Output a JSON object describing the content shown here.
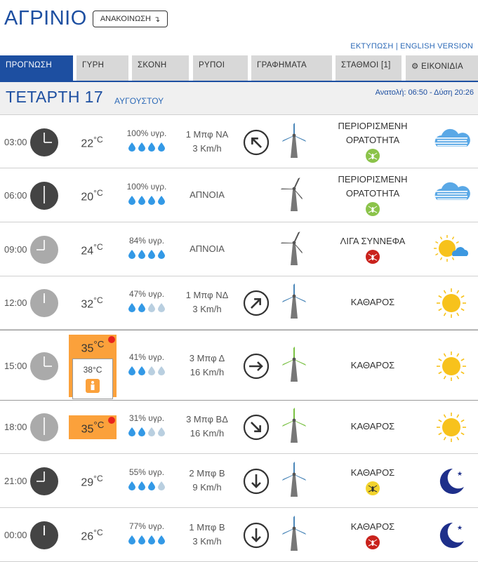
{
  "header": {
    "city": "ΑΓΡΙΝΙΟ",
    "announce_label": "ΑΝΑΚΟΙΝΩΣΗ",
    "print_link": "ΕΚΤΥΠΩΣΗ",
    "separator": "|",
    "english_link": "ENGLISH VERSION"
  },
  "tabs": [
    {
      "label": "ΠΡΟΓΝΩΣΗ",
      "active": true
    },
    {
      "label": "ΓΥΡΗ"
    },
    {
      "label": "ΣΚΟΝΗ"
    },
    {
      "label": "ΡΥΠΟΙ"
    },
    {
      "label": "ΓΡΑΦΗΜΑΤΑ"
    },
    {
      "label": "ΣΤΑΘΜΟΙ [1]"
    },
    {
      "label": "ΕΙΚΟΝΙΔΙΑ",
      "icon": "gear-icon"
    }
  ],
  "day": {
    "name": "ΤΕΤΑΡΤΗ 17",
    "month": "ΑΥΓΟΥΣΤΟΥ",
    "sun": "Ανατολή: 06:50  - Δύση 20:26"
  },
  "colors": {
    "brand": "#1d4fa1",
    "heat": "#fba13b",
    "drop_full": "#3399e6",
    "drop_empty": "#b9cfe0",
    "mosquito_green": "#8bc34a",
    "mosquito_red": "#c9221c",
    "mosquito_yellow": "#f2d32c"
  },
  "rows": [
    {
      "time": "03:00",
      "hour": 3,
      "clock": "dark",
      "temp": "22",
      "unit": "°C",
      "humidity": "100% υγρ.",
      "drops_full": 4,
      "wind1": "1 Μπφ ΝΑ",
      "wind2": "3 Km/h",
      "wind_dir": "NA",
      "turbine": "grey",
      "sky1": "ΠΕΡΙΟΡΙΣΜΕΝΗ",
      "sky2": "ΟΡΑΤΟΤΗΤΑ",
      "mosquito": "green",
      "weather": "fog-icon"
    },
    {
      "time": "06:00",
      "hour": 6,
      "clock": "dark",
      "temp": "20",
      "unit": "°C",
      "humidity": "100% υγρ.",
      "drops_full": 4,
      "wind1": "ΑΠΝΟΙΑ",
      "wind2": "",
      "wind_dir": "",
      "turbine": "calm",
      "sky1": "ΠΕΡΙΟΡΙΣΜΕΝΗ",
      "sky2": "ΟΡΑΤΟΤΗΤΑ",
      "mosquito": "green",
      "weather": "fog-icon"
    },
    {
      "time": "09:00",
      "hour": 9,
      "clock": "light",
      "temp": "24",
      "unit": "°C",
      "humidity": "84% υγρ.",
      "drops_full": 4,
      "wind1": "ΑΠΝΟΙΑ",
      "wind2": "",
      "wind_dir": "",
      "turbine": "calm",
      "sky1": "ΛΙΓΑ ΣΥΝΝΕΦΑ",
      "sky2": "",
      "mosquito": "red",
      "weather": "sun-cloud-icon"
    },
    {
      "time": "12:00",
      "hour": 12,
      "clock": "light",
      "temp": "32",
      "unit": "°C",
      "humidity": "47% υγρ.",
      "drops_full": 2,
      "wind1": "1 Μπφ ΝΔ",
      "wind2": "3 Km/h",
      "wind_dir": "ΝΔ",
      "turbine": "grey",
      "sky1": "ΚΑΘΑΡΟΣ",
      "sky2": "",
      "mosquito": "",
      "weather": "sun-icon"
    },
    {
      "time": "15:00",
      "hour": 15,
      "clock": "light",
      "temp": "35",
      "unit": "°C",
      "heat": true,
      "feels": "38°C",
      "humidity": "41% υγρ.",
      "drops_full": 2,
      "wind1": "3 Μπφ Δ",
      "wind2": "16 Km/h",
      "wind_dir": "Δ",
      "turbine": "green",
      "sky1": "ΚΑΘΑΡΟΣ",
      "sky2": "",
      "mosquito": "",
      "weather": "sun-icon"
    },
    {
      "time": "18:00",
      "hour": 18,
      "clock": "light",
      "temp": "35",
      "unit": "°C",
      "heat": true,
      "humidity": "31% υγρ.",
      "drops_full": 2,
      "wind1": "3 Μπφ ΒΔ",
      "wind2": "16 Km/h",
      "wind_dir": "ΒΔ",
      "turbine": "green",
      "sky1": "ΚΑΘΑΡΟΣ",
      "sky2": "",
      "mosquito": "",
      "weather": "sun-icon"
    },
    {
      "time": "21:00",
      "hour": 21,
      "clock": "dark",
      "temp": "29",
      "unit": "°C",
      "humidity": "55% υγρ.",
      "drops_full": 3,
      "wind1": "2 Μπφ Β",
      "wind2": "9 Km/h",
      "wind_dir": "Β",
      "turbine": "grey",
      "sky1": "ΚΑΘΑΡΟΣ",
      "sky2": "",
      "mosquito": "yellow",
      "weather": "moon-icon"
    },
    {
      "time": "00:00",
      "hour": 0,
      "clock": "dark",
      "temp": "26",
      "unit": "°C",
      "humidity": "77% υγρ.",
      "drops_full": 4,
      "wind1": "1 Μπφ Β",
      "wind2": "3 Km/h",
      "wind_dir": "Β",
      "turbine": "grey",
      "sky1": "ΚΑΘΑΡΟΣ",
      "sky2": "",
      "mosquito": "red",
      "weather": "moon-icon"
    }
  ]
}
